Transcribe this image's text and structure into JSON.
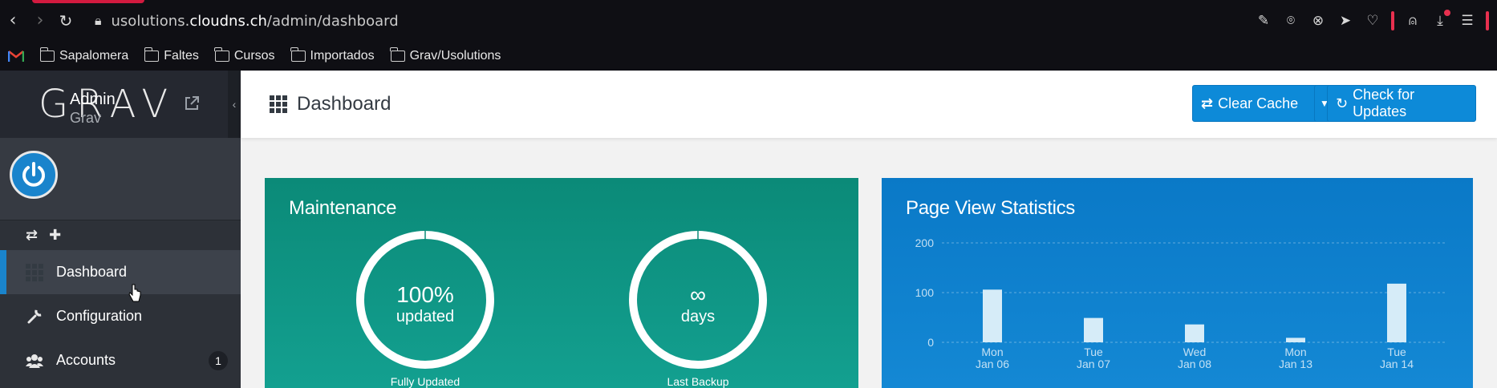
{
  "browser": {
    "url_prefix": "usolutions.",
    "url_domain": "cloudns.ch",
    "url_path": "/admin/dashboard",
    "bookmarks": [
      "Sapalomera",
      "Faltes",
      "Cursos",
      "Importados",
      "Grav/Usolutions"
    ]
  },
  "sidebar": {
    "logo": "GRAV",
    "user_name": "Admin",
    "user_role": "Grav",
    "items": [
      {
        "label": "Dashboard",
        "active": true
      },
      {
        "label": "Configuration"
      },
      {
        "label": "Accounts",
        "badge": "1"
      }
    ]
  },
  "header": {
    "title": "Dashboard",
    "clear_cache_label": "Clear Cache",
    "check_updates_label": "Check for Updates"
  },
  "maintenance": {
    "title": "Maintenance",
    "updated_value": "100%",
    "updated_unit": "updated",
    "updated_label": "Fully Updated",
    "backup_value": "∞",
    "backup_unit": "days",
    "backup_label": "Last Backup"
  },
  "chart_data": {
    "type": "bar",
    "title": "Page View Statistics",
    "categories": [
      "Mon\nJan 06",
      "Tue\nJan 07",
      "Wed\nJan 08",
      "Mon\nJan 13",
      "Tue\nJan 14"
    ],
    "category_lines": [
      [
        "Mon",
        "Jan 06"
      ],
      [
        "Tue",
        "Jan 07"
      ],
      [
        "Wed",
        "Jan 08"
      ],
      [
        "Mon",
        "Jan 13"
      ],
      [
        "Tue",
        "Jan 14"
      ]
    ],
    "values": [
      106,
      49,
      36,
      9,
      118
    ],
    "yticks": [
      0,
      100,
      200
    ],
    "ylim": [
      0,
      200
    ],
    "grid": true,
    "bar_color": "#d6ecf8"
  },
  "colors": {
    "accent": "#0d8ad8",
    "maintenance_bg": "#0b8a78",
    "sidebar_bg": "#2d3138"
  }
}
